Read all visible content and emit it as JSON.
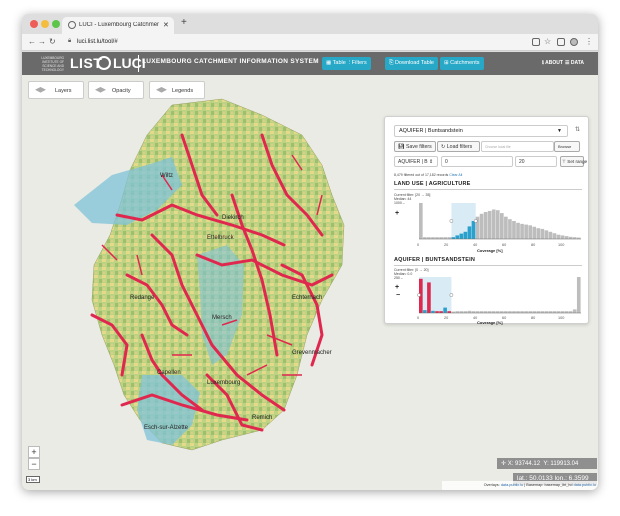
{
  "browser": {
    "tab_title": "LUCI - Luxembourg Catchment Information System",
    "url": "luci.list.lu/tool/#"
  },
  "header": {
    "institute": "LUXEMBOURG INSTITUTE OF SCIENCE AND TECHNOLOGY",
    "brand_list": "LIST",
    "brand_luci": "LUCI",
    "app_title": "LUXEMBOURG CATCHMENT INFORMATION SYSTEM",
    "buttons": {
      "table": "Table",
      "filters": "Filters",
      "download_table": "Download Table",
      "catchments": "Catchments"
    },
    "links": {
      "about": "ABOUT",
      "data": "DATA"
    }
  },
  "map": {
    "controls": {
      "layers": "Layers",
      "opacity": "Opacity",
      "legends": "Legends"
    },
    "cities": [
      "Diekirch",
      "Ettelbruck",
      "Wiltz",
      "Redange",
      "Mersch",
      "Echternach",
      "Luxembourg",
      "Capellen",
      "Esch-sur-Alzette",
      "Remich",
      "Grevenmacher"
    ],
    "zoom_in": "+",
    "zoom_out": "−",
    "coord_x": "X: 93744.12",
    "coord_y": "Y: 119913.04",
    "lat": "lat.: 50.0133",
    "lon": "lon.: 6.3599",
    "scale": "3 km",
    "attribution_prefix": "Overlays:",
    "attribution_link1": "data.public.lu",
    "attribution_mid": "| Basemap: basemap_lbt_hd",
    "attribution_link2": "data.public.lu",
    "colors": {
      "river": "#e0284f",
      "catchment": "#7fc3d9",
      "land_green": "#b6cf7a",
      "land_yellow": "#e8dc8a"
    }
  },
  "panel": {
    "aquifer_select": "AQUIFER | Buntsandstein",
    "save_filters": "Save filters",
    "load_filters": "Load filters",
    "filter_placeholder": "Choose local file",
    "browse": "Browse",
    "field_select": "AQUIFER | B",
    "min_value": "0",
    "max_value": "20",
    "set_range": "Set range",
    "records_text": "8,479 filtered out of 17,182 records",
    "clear_all": "Clear All",
    "section1": {
      "title": "LAND USE | AGRICULTURE",
      "filter_line": "Current filter: [20 → 35]",
      "median_line": "Median: 44",
      "ymax_label": "1000 –",
      "xticks": [
        "0",
        "20",
        "40",
        "60",
        "80",
        "100"
      ],
      "xlabel": "Coverage [%]"
    },
    "section2": {
      "title": "AQUIFER | BUNTSANDSTEIN",
      "filter_line": "Current filter: [0 → 20]",
      "median_line": "Median: 0.0",
      "ymax_label": "250 –",
      "xticks": [
        "0",
        "20",
        "40",
        "60",
        "80",
        "100"
      ],
      "xlabel": "Coverage [%]"
    }
  },
  "chart_data": [
    {
      "type": "bar",
      "title": "LAND USE | AGRICULTURE",
      "xlabel": "Coverage [%]",
      "xlim": [
        0,
        100
      ],
      "brush": [
        20,
        35
      ],
      "x": [
        0,
        2.5,
        5,
        7.5,
        10,
        12.5,
        15,
        17.5,
        20,
        22.5,
        25,
        27.5,
        30,
        32.5,
        35,
        37.5,
        40,
        42.5,
        45,
        47.5,
        50,
        52.5,
        55,
        57.5,
        60,
        62.5,
        65,
        67.5,
        70,
        72.5,
        75,
        77.5,
        80,
        82.5,
        85,
        87.5,
        90,
        92.5,
        95,
        97.5
      ],
      "values": [
        1.0,
        0.05,
        0.05,
        0.05,
        0.05,
        0.05,
        0.05,
        0.05,
        0.05,
        0.1,
        0.15,
        0.2,
        0.35,
        0.5,
        0.62,
        0.7,
        0.75,
        0.78,
        0.82,
        0.8,
        0.72,
        0.62,
        0.55,
        0.5,
        0.45,
        0.42,
        0.4,
        0.38,
        0.34,
        0.3,
        0.28,
        0.24,
        0.2,
        0.16,
        0.12,
        0.1,
        0.08,
        0.06,
        0.05,
        0.04
      ]
    },
    {
      "type": "bar",
      "title": "AQUIFER | BUNTSANDSTEIN",
      "xlabel": "Coverage [%]",
      "xlim": [
        0,
        100
      ],
      "brush": [
        0,
        20
      ],
      "x": [
        0,
        2.5,
        5,
        7.5,
        10,
        12.5,
        15,
        17.5,
        20,
        22.5,
        25,
        27.5,
        30,
        32.5,
        35,
        37.5,
        40,
        42.5,
        45,
        47.5,
        50,
        52.5,
        55,
        57.5,
        60,
        62.5,
        65,
        67.5,
        70,
        72.5,
        75,
        77.5,
        80,
        82.5,
        85,
        87.5,
        90,
        92.5,
        95,
        97.5
      ],
      "values": [
        0.95,
        0.08,
        0.85,
        0.06,
        0.05,
        0.05,
        0.15,
        0.05,
        0.04,
        0.05,
        0.05,
        0.05,
        0.06,
        0.05,
        0.05,
        0.05,
        0.05,
        0.05,
        0.05,
        0.05,
        0.05,
        0.05,
        0.05,
        0.05,
        0.05,
        0.05,
        0.05,
        0.05,
        0.05,
        0.05,
        0.05,
        0.05,
        0.05,
        0.05,
        0.05,
        0.05,
        0.05,
        0.05,
        0.1,
        1.0
      ]
    }
  ]
}
